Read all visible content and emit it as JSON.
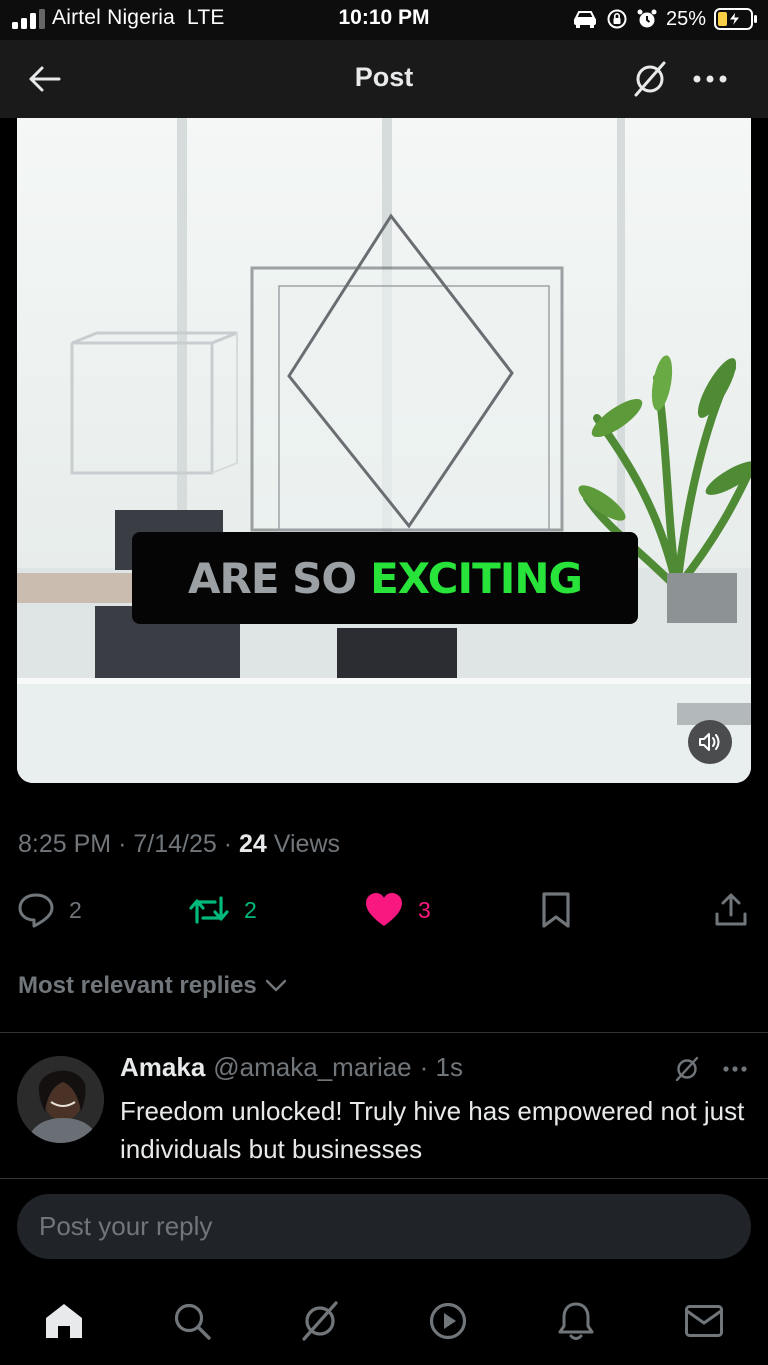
{
  "status_bar": {
    "carrier": "Airtel Nigeria",
    "network": "LTE",
    "time": "10:10 PM",
    "battery": "25%",
    "icons": [
      "signal-icon",
      "car-icon",
      "orientation-lock-icon",
      "alarm-icon",
      "battery-charging-icon"
    ]
  },
  "header": {
    "title": "Post",
    "icons": [
      "back-arrow-icon",
      "grok-icon",
      "more-icon"
    ]
  },
  "video": {
    "caption_part1": "ARE SO",
    "caption_part2": "EXCITING",
    "caption_colors": {
      "part1": "#9aa0a4",
      "part2": "#27e33a"
    },
    "icons": [
      "volume-icon"
    ]
  },
  "meta": {
    "time": "8:25 PM",
    "date": "7/14/25",
    "views_count": "24",
    "views_label": "Views",
    "separator": "·"
  },
  "actions": {
    "replies": "2",
    "reposts": "2",
    "likes": "3",
    "colors": {
      "repost": "#00ba7c",
      "like": "#f91880"
    },
    "icons": [
      "reply-icon",
      "repost-icon",
      "heart-icon",
      "bookmark-icon",
      "share-icon"
    ]
  },
  "replies_sort": {
    "label": "Most relevant replies",
    "icon": "chevron-down-icon"
  },
  "reply": {
    "name": "Amaka",
    "handle": "@amaka_mariae",
    "time": "· 1s",
    "text": "Freedom unlocked! Truly hive has empowered not just individuals but businesses"
  },
  "composer": {
    "placeholder": "Post your reply"
  },
  "tabbar": {
    "tabs": [
      "home-icon",
      "search-icon",
      "grok-icon",
      "video-icon",
      "notifications-icon",
      "messages-icon"
    ]
  }
}
